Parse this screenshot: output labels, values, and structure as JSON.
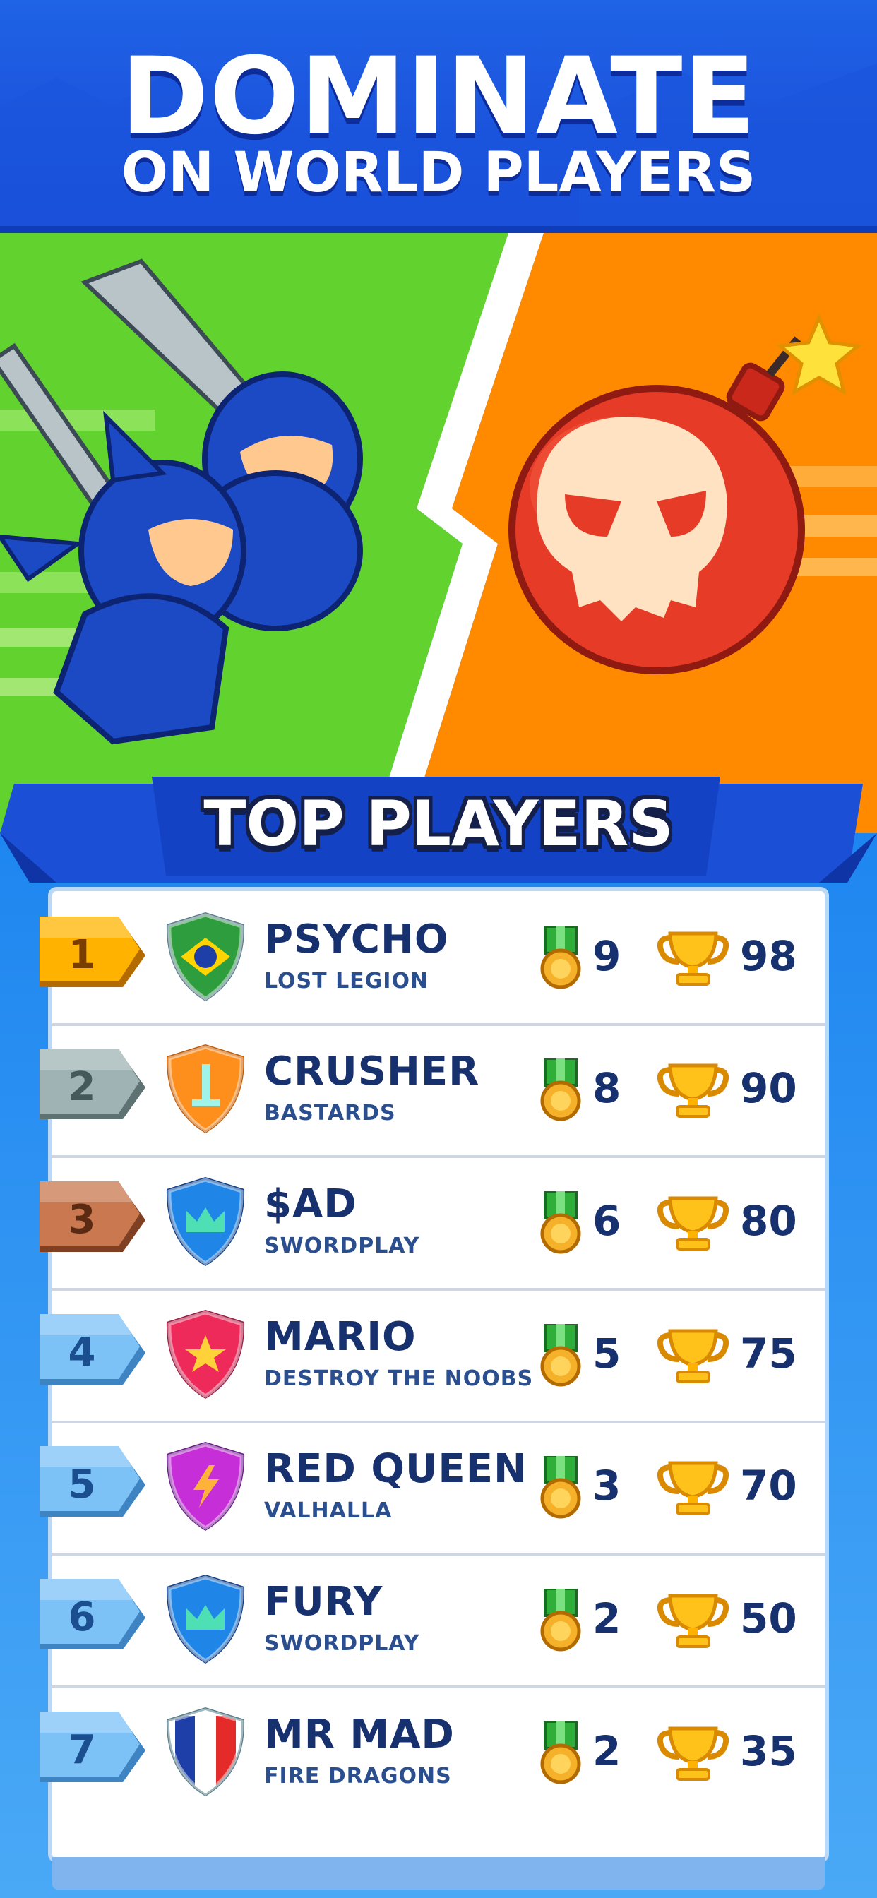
{
  "header": {
    "title": "DOMINATE",
    "subtitle": "ON WORLD PLAYERS"
  },
  "leaderboard": {
    "title": "TOP PLAYERS",
    "players": [
      {
        "rank": "1",
        "name": "PSYCHO",
        "clan": "LOST LEGION",
        "medals": "9",
        "trophies": "98",
        "badge": "brazil-flag-shield-icon"
      },
      {
        "rank": "2",
        "name": "CRUSHER",
        "clan": "BASTARDS",
        "medals": "8",
        "trophies": "90",
        "badge": "sword-shield-icon"
      },
      {
        "rank": "3",
        "name": "$AD",
        "clan": "SWORDPLAY",
        "medals": "6",
        "trophies": "80",
        "badge": "crown-shield-icon"
      },
      {
        "rank": "4",
        "name": "MARIO",
        "clan": "DESTROY THE NOOBS",
        "medals": "5",
        "trophies": "75",
        "badge": "star-shield-icon"
      },
      {
        "rank": "5",
        "name": "RED QUEEN",
        "clan": "VALHALLA",
        "medals": "3",
        "trophies": "70",
        "badge": "lightning-shield-icon"
      },
      {
        "rank": "6",
        "name": "FURY",
        "clan": "SWORDPLAY",
        "medals": "2",
        "trophies": "50",
        "badge": "crown-shield-icon"
      },
      {
        "rank": "7",
        "name": "MR MAD",
        "clan": "FIRE DRAGONS",
        "medals": "2",
        "trophies": "35",
        "badge": "france-flag-shield-icon"
      }
    ]
  },
  "colors": {
    "header_blue": "#1f5fe4",
    "green_side": "#5fd32d",
    "orange_side": "#ff8a00",
    "name_text": "#17306e",
    "rank_gold": "#ffb300",
    "rank_silver": "#9fb3b4",
    "rank_bronze": "#c9784f",
    "rank_blue": "#7cc2f7"
  }
}
